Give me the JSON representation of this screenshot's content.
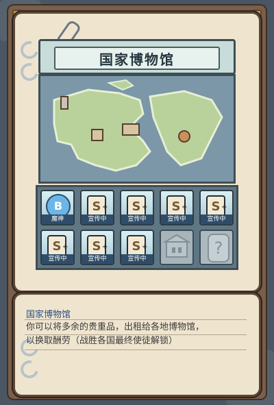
{
  "header": {
    "title": "国家博物馆"
  },
  "slots": [
    {
      "type": "B",
      "badge": "B",
      "label": "魔神"
    },
    {
      "type": "S",
      "badge": "S",
      "label": "宣传中"
    },
    {
      "type": "S",
      "badge": "S",
      "label": "宣传中"
    },
    {
      "type": "S",
      "badge": "S",
      "label": "宣传中"
    },
    {
      "type": "S",
      "badge": "S",
      "label": "宣传中"
    },
    {
      "type": "S",
      "badge": "S",
      "label": "宣传中"
    },
    {
      "type": "S",
      "badge": "S",
      "label": "宣传中"
    },
    {
      "type": "S",
      "badge": "S",
      "label": "宣传中"
    },
    {
      "type": "locked",
      "label": ""
    },
    {
      "type": "unknown",
      "badge": "?",
      "label": ""
    }
  ],
  "description": {
    "title": "国家博物馆",
    "lines": [
      "你可以将多余的贵重品，出租给各地博物馆，",
      "以换取酬劳（战胜各国最终使徒解锁）"
    ]
  },
  "colors": {
    "panel": "#efe5cf",
    "frame": "#7b5f49",
    "label_bg": "#2f4d68"
  }
}
